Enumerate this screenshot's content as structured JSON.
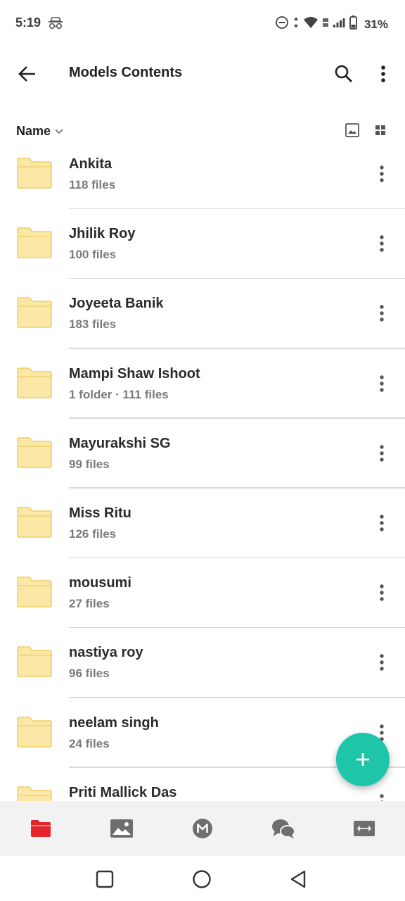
{
  "status_bar": {
    "time": "5:19",
    "battery": "31%"
  },
  "app_bar": {
    "title": "Models Contents"
  },
  "sort": {
    "label": "Name"
  },
  "folders": [
    {
      "name": "Ankita",
      "meta": "118 files"
    },
    {
      "name": "Jhilik Roy",
      "meta": "100 files"
    },
    {
      "name": "Joyeeta Banik",
      "meta": "183 files"
    },
    {
      "name": "Mampi Shaw Ishoot",
      "meta": "1 folder · 111 files"
    },
    {
      "name": "Mayurakshi SG",
      "meta": "99 files"
    },
    {
      "name": "Miss Ritu",
      "meta": "126 files"
    },
    {
      "name": "mousumi",
      "meta": "27 files"
    },
    {
      "name": "nastiya roy",
      "meta": "96 files"
    },
    {
      "name": "neelam singh",
      "meta": "24 files"
    },
    {
      "name": "Priti Mallick Das",
      "meta": ""
    }
  ],
  "icons": {
    "back": "back-arrow-icon",
    "search": "search-icon",
    "more": "more-vert-icon",
    "folder": "folder-icon",
    "fab": "plus-icon",
    "nav": [
      "files-icon",
      "photos-icon",
      "mega-icon",
      "chat-icon",
      "transfers-icon"
    ]
  },
  "colors": {
    "folder": "#fbe7a6",
    "folder_stroke": "#f2d270",
    "fab": "#1fc5a9",
    "active_nav": "#e5252b",
    "nav_icon": "#6e6e6e"
  }
}
